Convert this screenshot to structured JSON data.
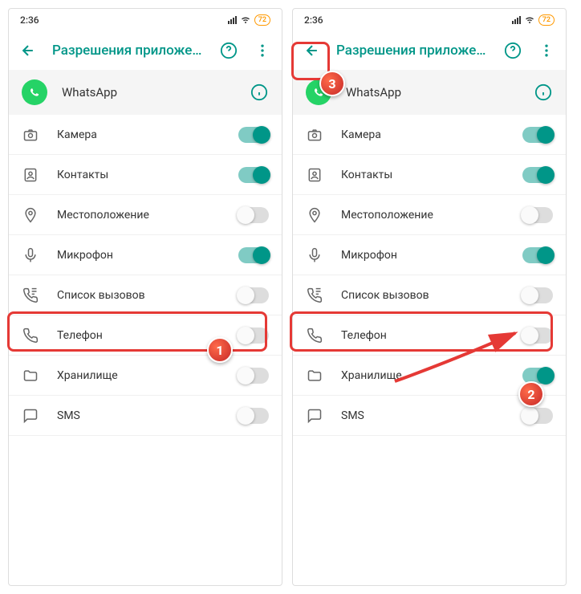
{
  "status": {
    "time": "2:36",
    "battery": "72"
  },
  "header": {
    "title": "Разрешения приложе…"
  },
  "app": {
    "name": "WhatsApp"
  },
  "perm": {
    "camera": "Камера",
    "contacts": "Контакты",
    "location": "Местоположение",
    "mic": "Микрофон",
    "calllog": "Список вызовов",
    "phone": "Телефон",
    "storage": "Хранилище",
    "sms": "SMS"
  },
  "badges": {
    "b1": "1",
    "b2": "2",
    "b3": "3"
  },
  "screens": [
    {
      "storage_on": false
    },
    {
      "storage_on": true
    }
  ]
}
